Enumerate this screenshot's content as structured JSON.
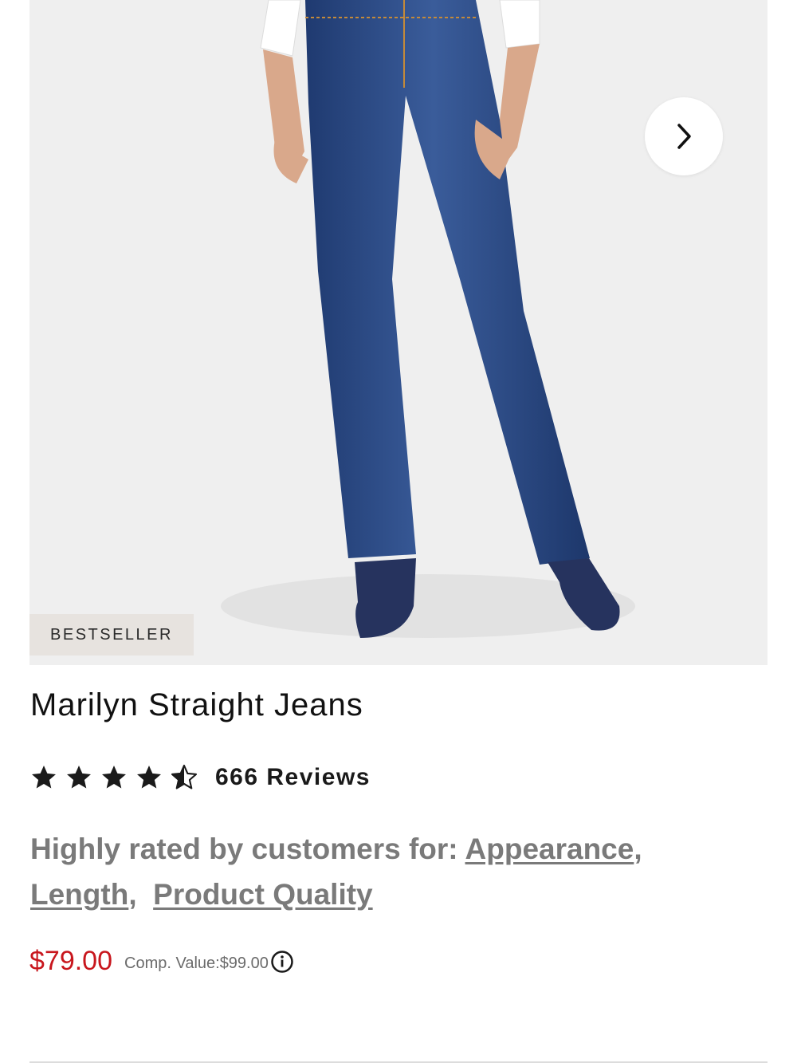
{
  "product": {
    "badge": "BESTSELLER",
    "title": "Marilyn Straight Jeans",
    "rating": {
      "value": 4.5,
      "max": 5,
      "reviews_label": "666 Reviews"
    },
    "highly_rated": {
      "prefix": "Highly rated by customers for:",
      "attributes": [
        "Appearance",
        "Length",
        "Product Quality"
      ]
    },
    "price": "$79.00",
    "comp_value": "Comp. Value:$99.00"
  },
  "icons": {
    "next": "chevron-right-icon",
    "info": "info-icon",
    "star": "star-icon"
  },
  "colors": {
    "price": "#c8161d",
    "badge_bg": "#e7e3df",
    "image_bg": "#efefef",
    "denim": "#2f4e8c"
  }
}
